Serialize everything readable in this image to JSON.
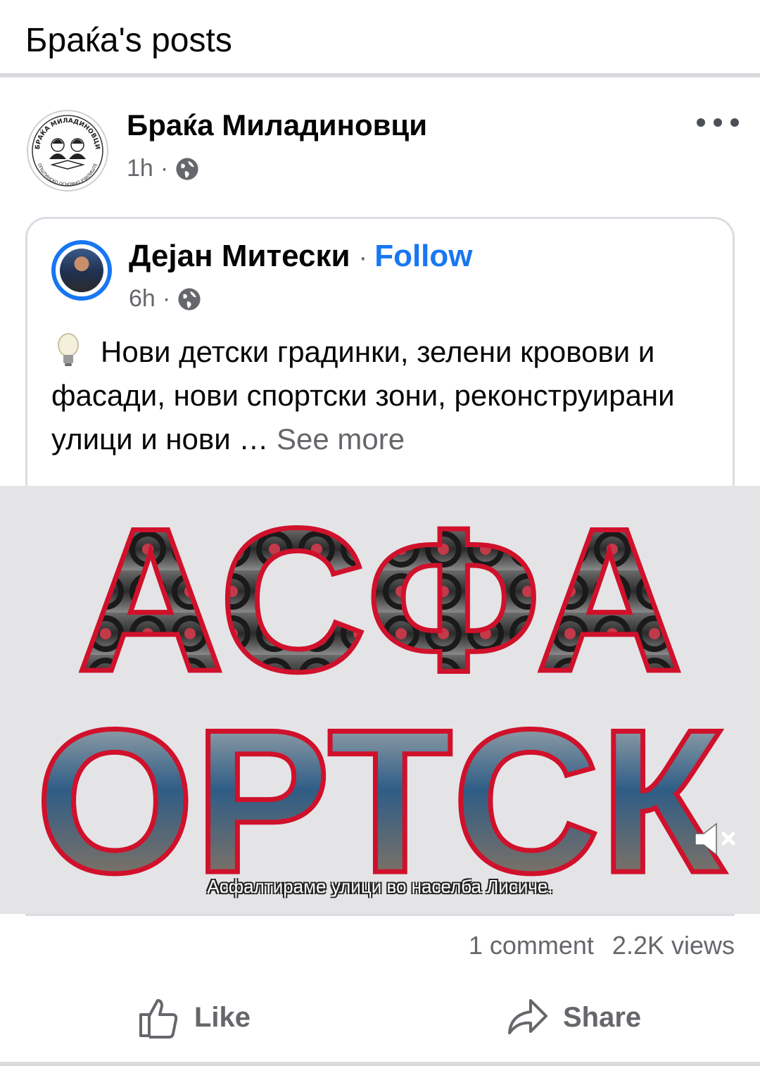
{
  "header": {
    "title": "Браќа's posts"
  },
  "post": {
    "author": "Браќа Миладиновци",
    "time": "1h",
    "separator": "·",
    "avatar_ring_text": "БРАЌА МИЛАДИНОВЦИ",
    "avatar_bottom_text": "ОПШТИНСКО ОСНОВНО УЧИЛИШТЕ",
    "shared": {
      "author": "Дејан Митески",
      "follow_separator": "·",
      "follow_label": "Follow",
      "time": "6h",
      "separator": "·",
      "text": "Нови детски градинки, зелени кровови и фасади, нови спортски зони, реконструирани улици и нови …",
      "see_more": "See more"
    },
    "video": {
      "overlay_line1": "АСФА",
      "overlay_line2": "ОРТСК",
      "caption": "Асфалтираме улици во населба Лисиче."
    },
    "stats": {
      "comments": "1 comment",
      "views": "2.2K views"
    },
    "actions": {
      "like": "Like",
      "share": "Share"
    }
  },
  "colors": {
    "link_blue": "#1877f2",
    "secondary_text": "#65676b",
    "divider": "#d9dadd",
    "overlay_red": "#d0112b"
  },
  "icons": [
    "globe-icon",
    "more-icon",
    "lightbulb-icon",
    "mute-icon",
    "like-icon",
    "share-icon"
  ]
}
